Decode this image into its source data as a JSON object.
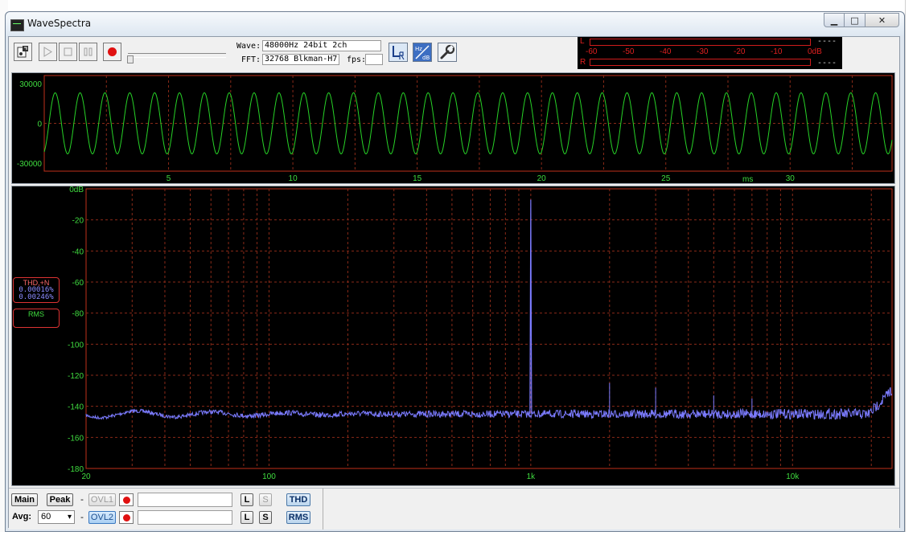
{
  "window": {
    "title": "WaveSpectra",
    "minimize": "▁",
    "maximize": "□",
    "close": "✕"
  },
  "toolbar": {
    "wave_label": "Wave:",
    "wave_value": "48000Hz 24bit 2ch",
    "fft_label": "FFT:",
    "fft_value": "32768 Blkman-H7",
    "fps_label": "fps:",
    "fps_value": "",
    "play_icon": "play-icon",
    "stop_icon": "stop-icon",
    "pause_icon": "pause-icon"
  },
  "meter": {
    "left_label": "L",
    "right_label": "R",
    "scale": [
      "-60",
      "-50",
      "-40",
      "-30",
      "-20",
      "-10",
      "0dB"
    ],
    "left_value": "----",
    "right_value": "----",
    "color": "#e02020"
  },
  "wave_plot": {
    "y_ticks": [
      {
        "v": 30000,
        "label": "30000"
      },
      {
        "v": 0,
        "label": "0"
      },
      {
        "v": -30000,
        "label": "-30000"
      }
    ],
    "x_ticks": [
      {
        "v": 5,
        "label": "5"
      },
      {
        "v": 10,
        "label": "10"
      },
      {
        "v": 15,
        "label": "15"
      },
      {
        "v": 20,
        "label": "20"
      },
      {
        "v": 25,
        "label": "25"
      },
      {
        "v": 30,
        "label": "30"
      }
    ],
    "x_unit": "ms",
    "x_range": [
      0,
      34.1
    ],
    "amplitude": 23000,
    "frequency_hz": 1000,
    "trace_color": "#27d327",
    "grid_color": "#8a2a18"
  },
  "spectrum_plot": {
    "y_ticks": [
      {
        "v": 0,
        "label": "0dB"
      },
      {
        "v": -20,
        "label": "-20"
      },
      {
        "v": -40,
        "label": "-40"
      },
      {
        "v": -60,
        "label": "-60"
      },
      {
        "v": -80,
        "label": "-80"
      },
      {
        "v": -100,
        "label": "-100"
      },
      {
        "v": -120,
        "label": "-120"
      },
      {
        "v": -140,
        "label": "-140"
      },
      {
        "v": -160,
        "label": "-160"
      },
      {
        "v": -180,
        "label": "-180"
      }
    ],
    "x_ticks": [
      {
        "v": 20,
        "label": "20"
      },
      {
        "v": 100,
        "label": "100"
      },
      {
        "v": 1000,
        "label": "1k"
      },
      {
        "v": 10000,
        "label": "10k"
      }
    ],
    "x_range": [
      20,
      24000
    ],
    "y_range": [
      -180,
      0
    ],
    "peak_freq": 1000,
    "peak_db": -7,
    "noise_floor_db": -145,
    "harmonics": [
      {
        "f": 2000,
        "db": -125
      },
      {
        "f": 3000,
        "db": -128
      },
      {
        "f": 5000,
        "db": -133
      },
      {
        "f": 7000,
        "db": -135
      }
    ],
    "trace_color": "#7b7bff",
    "grid_color": "#8a2a18"
  },
  "overlay": {
    "thd_label": "THD,+N",
    "thd_value1": "0.00016%",
    "thd_value2": "0.00246%",
    "rms_label": "RMS"
  },
  "controls": {
    "main": "Main",
    "peak": "Peak",
    "avg_label": "Avg:",
    "avg_value": "60",
    "ovl1": "OVL1",
    "ovl2": "OVL2",
    "dash": "-",
    "l": "L",
    "s": "S",
    "thd": "THD",
    "rms": "RMS"
  }
}
